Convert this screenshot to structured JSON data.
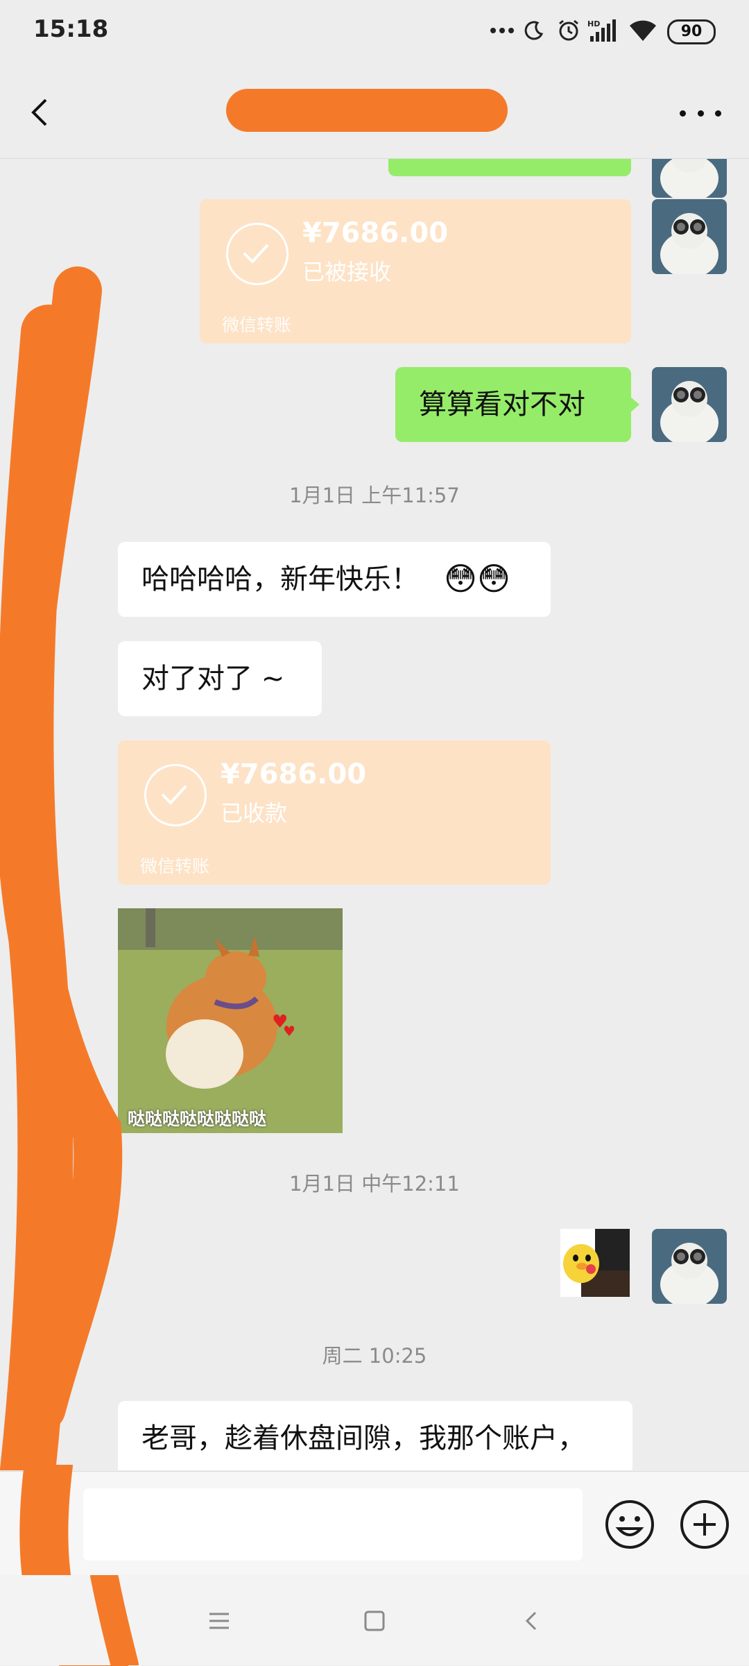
{
  "status_bar": {
    "time": "15:18",
    "battery": "90",
    "icons": [
      "more-dots-icon",
      "moon-icon",
      "alarm-icon",
      "hd-signal-icon",
      "wifi-icon",
      "battery-icon"
    ]
  },
  "nav": {
    "title": "",
    "back_icon": "chevron-left-icon",
    "more_icon": "more-dots-icon"
  },
  "messages": {
    "transfer_sent": {
      "amount": "¥7686.00",
      "status": "已被接收",
      "footer": "微信转账"
    },
    "sent_text": "算算看对不对",
    "timestamp_1": "1月1日 上午11:57",
    "recv_text_1": "哈哈哈哈，新年快乐！",
    "recv_text_1_emoji": "😳😳",
    "recv_text_2": "对了对了 ~",
    "transfer_received": {
      "amount": "¥7686.00",
      "status": "已收款",
      "footer": "微信转账"
    },
    "sticker_caption": "哒哒哒哒哒哒哒哒",
    "timestamp_2": "1月1日 中午12:11",
    "timestamp_3": "周二 10:25",
    "recv_text_3": "老哥，趁着休盘间隙，我那个账户，"
  },
  "input_bar": {
    "placeholder": "",
    "voice_icon": "voice-icon",
    "emoji_icon": "emoji-icon",
    "plus_icon": "plus-icon"
  },
  "system_nav": {
    "icons": [
      "menu-icon",
      "home-icon",
      "back-icon"
    ]
  },
  "colors": {
    "background": "#ededed",
    "sent_bubble": "#95ec69",
    "received_bubble": "#ffffff",
    "transfer_card": "#fde2c6",
    "redaction": "#f47a2a"
  }
}
